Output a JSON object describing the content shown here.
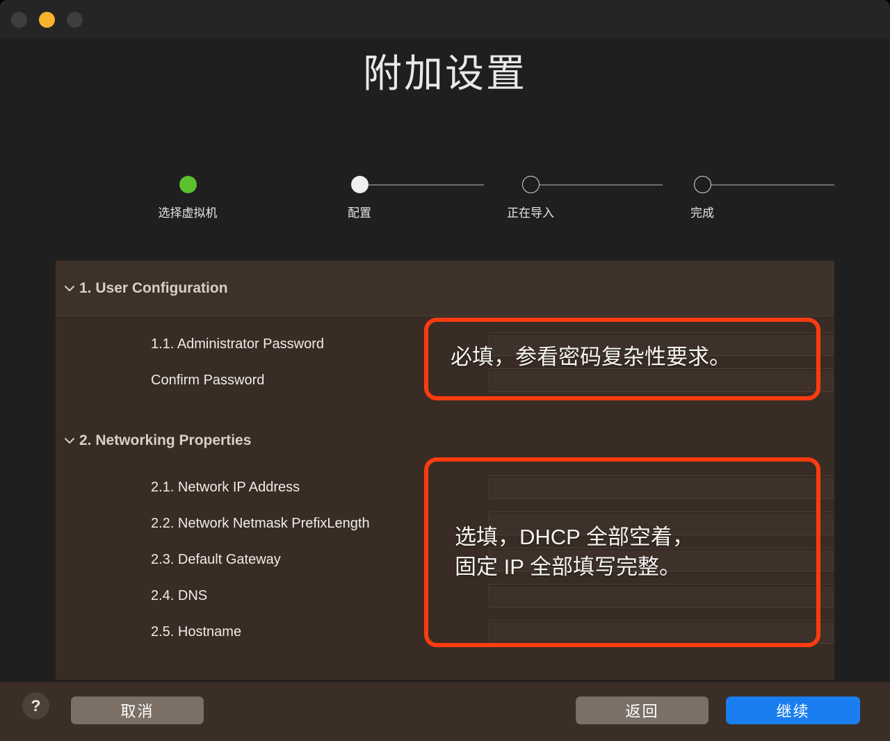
{
  "window": {
    "traffic_lights": [
      "close",
      "minimize",
      "zoom"
    ]
  },
  "header": {
    "title": "附加设置"
  },
  "stepper": {
    "steps": [
      {
        "label": "选择虚拟机",
        "state": "done"
      },
      {
        "label": "配置",
        "state": "current"
      },
      {
        "label": "正在导入",
        "state": "todo"
      },
      {
        "label": "完成",
        "state": "todo"
      }
    ]
  },
  "form": {
    "sections": [
      {
        "title": "1. User Configuration",
        "rows": [
          {
            "label": "1.1. Administrator Password",
            "value": "",
            "has_info": true
          },
          {
            "label": "Confirm Password",
            "value": "",
            "has_info": false
          }
        ]
      },
      {
        "title": "2. Networking Properties",
        "rows": [
          {
            "label": "2.1. Network IP Address",
            "value": "",
            "has_info": true
          },
          {
            "label": "2.2. Network Netmask PrefixLength",
            "value": "",
            "has_info": true
          },
          {
            "label": "2.3. Default Gateway",
            "value": "",
            "has_info": true
          },
          {
            "label": "2.4. DNS",
            "value": "",
            "has_info": true
          },
          {
            "label": "2.5. Hostname",
            "value": "",
            "has_info": true
          }
        ]
      }
    ]
  },
  "annotations": [
    {
      "text": "必填，参看密码复杂性要求。"
    },
    {
      "text": "选填，DHCP 全部空着，\n固定 IP 全部填写完整。"
    }
  ],
  "toolbar": {
    "help_label": "?",
    "cancel_label": "取消",
    "back_label": "返回",
    "continue_label": "继续"
  },
  "colors": {
    "background": "#1f1f1f",
    "panel": "#382c24",
    "section_header": "#3d3129",
    "accent_blue": "#1b7ef0",
    "annotation_red": "#ff3b10",
    "step_done_green": "#5cc12e",
    "info_blue": "#4a74dd"
  }
}
